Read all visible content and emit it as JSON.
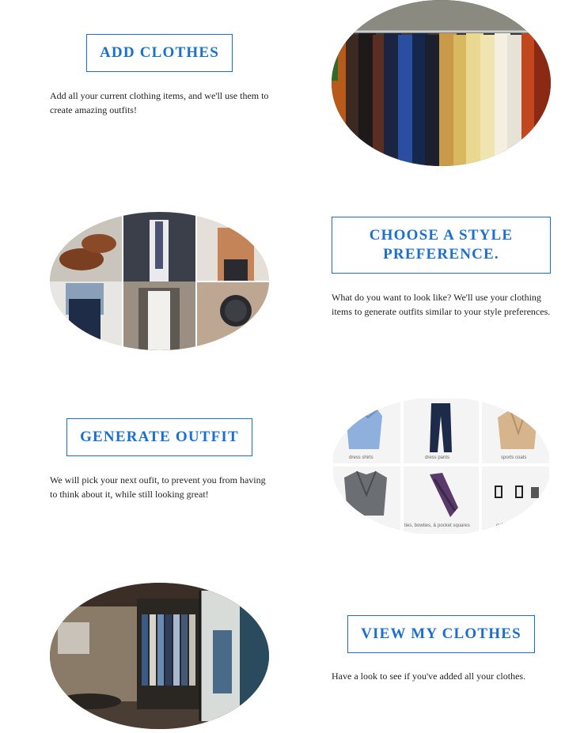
{
  "sections": [
    {
      "button": "ADD CLOTHES",
      "description": "Add all your current clothing items, and we'll use them to create amazing outfits!",
      "image_icon": "clothing-rack-image"
    },
    {
      "button": "CHOOSE A STYLE PREFERENCE.",
      "description": "What do you want to look like? We'll use your clothing items to generate outfits similar to your style preferences.",
      "image_icon": "menswear-collage-image"
    },
    {
      "button": "GENERATE OUTFIT",
      "description": "We will pick your next oufit, to prevent you from having to think about it, while still looking great!",
      "image_icon": "product-grid-image",
      "grid_labels": [
        "dress shirts",
        "dress pants",
        "sports coats",
        "ties, bowties, & pocket squares",
        "cuf"
      ]
    },
    {
      "button": "VIEW MY CLOTHES",
      "description": "Have a look to see if you've added all your clothes.",
      "image_icon": "clothing-store-image"
    }
  ],
  "colors": {
    "accent": "#1a6fd0",
    "text": "#222222"
  }
}
